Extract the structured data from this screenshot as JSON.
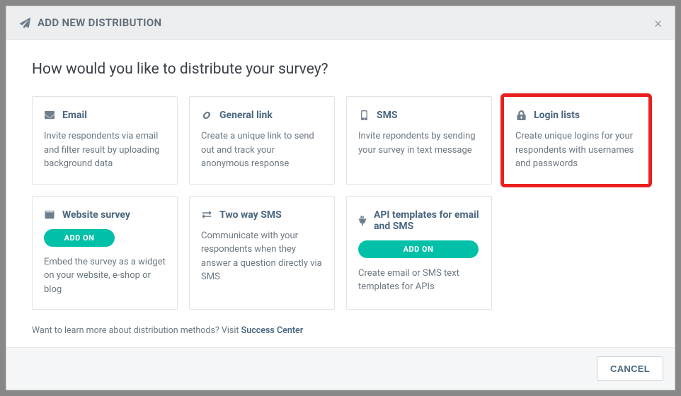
{
  "header": {
    "title": "ADD NEW DISTRIBUTION"
  },
  "body": {
    "question": "How would you like to distribute your survey?",
    "cards": {
      "email": {
        "title": "Email",
        "desc": "Invite respondents via email and filter result by uploading background data"
      },
      "link": {
        "title": "General link",
        "desc": "Create a unique link to send out and track your anonymous response"
      },
      "sms": {
        "title": "SMS",
        "desc": "Invite repondents by sending your survey in text message"
      },
      "login": {
        "title": "Login lists",
        "desc": "Create unique logins for your respondents with usernames and passwords"
      },
      "website": {
        "title": "Website survey",
        "addon": "ADD ON",
        "desc": "Embed the survey as a widget on your website, e-shop or blog"
      },
      "twoway": {
        "title": "Two way SMS",
        "desc": "Communicate with your respondents when they answer a question directly via SMS"
      },
      "api": {
        "title": "API templates for email and SMS",
        "addon": "ADD ON",
        "desc": "Create email or SMS text templates for APIs"
      }
    },
    "footer_note_prefix": "Want to learn more about distribution methods? Visit ",
    "footer_note_link": "Success Center"
  },
  "footer": {
    "cancel": "CANCEL"
  }
}
